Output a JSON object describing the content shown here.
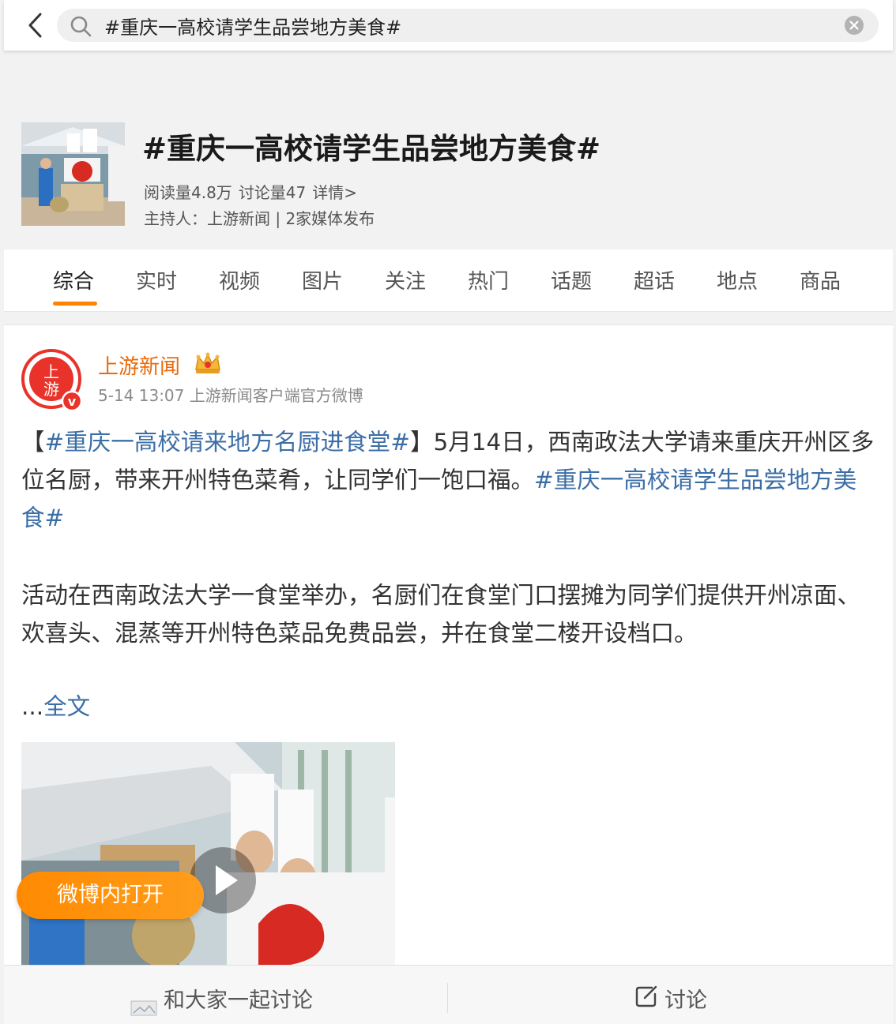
{
  "search": {
    "query": "#重庆一高校请学生品尝地方美食#"
  },
  "topic": {
    "title": "#重庆一高校请学生品尝地方美食#",
    "reads": "阅读量4.8万",
    "discussions": "讨论量47",
    "details": "详情>",
    "host_line": "主持人：上游新闻 | 2家媒体发布"
  },
  "tabs": [
    "综合",
    "实时",
    "视频",
    "图片",
    "关注",
    "热门",
    "话题",
    "超话",
    "地点",
    "商品"
  ],
  "post": {
    "author": "上游新闻",
    "avatar_text": "上游",
    "meta": "5-14 13:07 上游新闻客户端官方微博",
    "bracket_open": "【",
    "topic_link_1": "#重庆一高校请来地方名厨进食堂#",
    "bracket_close": "】",
    "text_1": "5月14日，西南政法大学请来重庆开州区多位名厨，带来开州特色菜肴，让同学们一饱口福。",
    "topic_link_2": "#重庆一高校请学生品尝地方美食#",
    "paragraph_2": "活动在西南政法大学一食堂举办，名厨们在食堂门口摆摊为同学们提供开州凉面、欢喜头、混蒸等开州特色菜品免费品尝，并在食堂二楼开设档口。",
    "ellipsis": "...",
    "full_text_link": "全文"
  },
  "open_in_app": "微博内打开",
  "bottom_bar": {
    "discuss_together": "和大家一起讨论",
    "discuss": "讨论"
  },
  "colors": {
    "accent": "#ff8200",
    "author_name": "#e86b0c",
    "topic_link": "#3c6ea6",
    "verified_badge": "#e8322a"
  }
}
